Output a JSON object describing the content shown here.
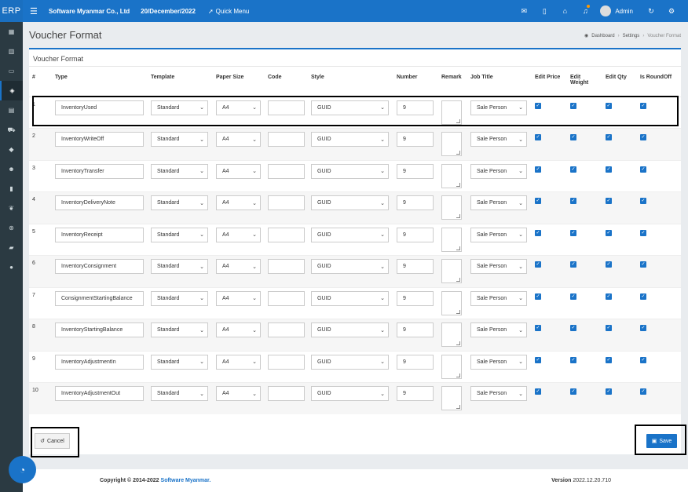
{
  "app": {
    "brand": "ERP",
    "company": "Software Myanmar Co., Ltd",
    "date": "20/December/2022",
    "quick_menu": "Quick Menu",
    "user": "Admin"
  },
  "page": {
    "title": "Voucher Format",
    "breadcrumb": [
      "Dashboard",
      "Settings",
      "Voucher Format"
    ],
    "card_title": "Voucher Format"
  },
  "columns": [
    "#",
    "Type",
    "Template",
    "Paper Size",
    "Code",
    "Style",
    "Number",
    "Remark",
    "Job Title",
    "Edit Price",
    "Edit Weight",
    "Edit Qty",
    "Is RoundOff"
  ],
  "rows": [
    {
      "num": "1",
      "type": "InventoryUsed",
      "template": "Standard",
      "paper": "A4",
      "code": "",
      "style": "GUID",
      "number": "9",
      "job": "Sale Person"
    },
    {
      "num": "2",
      "type": "InventoryWriteOff",
      "template": "Standard",
      "paper": "A4",
      "code": "",
      "style": "GUID",
      "number": "9",
      "job": "Sale Person"
    },
    {
      "num": "3",
      "type": "InventoryTransfer",
      "template": "Standard",
      "paper": "A4",
      "code": "",
      "style": "GUID",
      "number": "9",
      "job": "Sale Person"
    },
    {
      "num": "4",
      "type": "InventoryDeliveryNote",
      "template": "Standard",
      "paper": "A4",
      "code": "",
      "style": "GUID",
      "number": "9",
      "job": "Sale Person"
    },
    {
      "num": "5",
      "type": "InventoryReceipt",
      "template": "Standard",
      "paper": "A4",
      "code": "",
      "style": "GUID",
      "number": "9",
      "job": "Sale Person"
    },
    {
      "num": "6",
      "type": "InventoryConsignment",
      "template": "Standard",
      "paper": "A4",
      "code": "",
      "style": "GUID",
      "number": "9",
      "job": "Sale Person"
    },
    {
      "num": "7",
      "type": "ConsignmentStartingBalance",
      "template": "Standard",
      "paper": "A4",
      "code": "",
      "style": "GUID",
      "number": "9",
      "job": "Sale Person"
    },
    {
      "num": "8",
      "type": "InventoryStartingBalance",
      "template": "Standard",
      "paper": "A4",
      "code": "",
      "style": "GUID",
      "number": "9",
      "job": "Sale Person"
    },
    {
      "num": "9",
      "type": "InventoryAdjustmentIn",
      "template": "Standard",
      "paper": "A4",
      "code": "",
      "style": "GUID",
      "number": "9",
      "job": "Sale Person"
    },
    {
      "num": "10",
      "type": "InventoryAdjustmentOut",
      "template": "Standard",
      "paper": "A4",
      "code": "",
      "style": "GUID",
      "number": "9",
      "job": "Sale Person"
    }
  ],
  "buttons": {
    "cancel": "Cancel",
    "save": "Save"
  },
  "footer": {
    "copyright_prefix": "Copyright © 2014-2022",
    "copyright_brand": "Software Myanmar.",
    "version_label": "Version",
    "version": "2022.12.20.710"
  },
  "colors": {
    "primary": "#1a73c8",
    "sidebar": "#2b3a42"
  }
}
